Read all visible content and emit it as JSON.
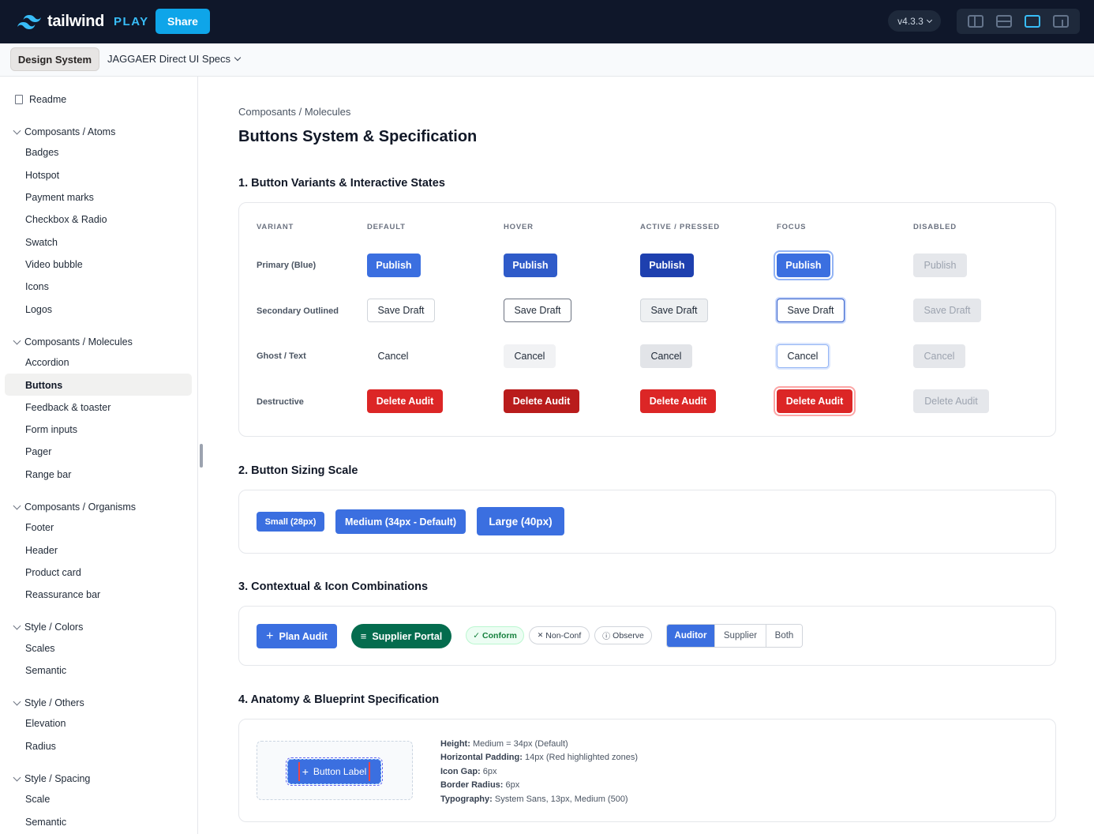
{
  "topbar": {
    "logo_text": "tailwind",
    "logo_suffix": "PLAY",
    "share_label": "Share",
    "version": "v4.3.3",
    "layout_icons": [
      "layout-split-vertical-icon",
      "layout-split-horizontal-icon",
      "layout-preview-icon",
      "layout-responsive-icon"
    ]
  },
  "subbar": {
    "active_tab": "Design System",
    "document": "JAGGAER Direct UI Specs"
  },
  "sidebar": {
    "readme": "Readme",
    "groups": [
      {
        "label": "Composants / Atoms",
        "items": [
          "Badges",
          "Hotspot",
          "Payment marks",
          "Checkbox & Radio",
          "Swatch",
          "Video bubble",
          "Icons",
          "Logos"
        ]
      },
      {
        "label": "Composants / Molecules",
        "items": [
          "Accordion",
          "Buttons",
          "Feedback & toaster",
          "Form inputs",
          "Pager",
          "Range bar"
        ]
      },
      {
        "label": "Composants / Organisms",
        "items": [
          "Footer",
          "Header",
          "Product card",
          "Reassurance bar"
        ]
      },
      {
        "label": "Style / Colors",
        "items": [
          "Scales",
          "Semantic"
        ]
      },
      {
        "label": "Style / Others",
        "items": [
          "Elevation",
          "Radius"
        ]
      },
      {
        "label": "Style / Spacing",
        "items": [
          "Scale",
          "Semantic"
        ]
      }
    ],
    "active_item": "Buttons"
  },
  "main": {
    "breadcrumb": "Composants / Molecules",
    "title": "Buttons System & Specification",
    "section1": {
      "title": "1. Button Variants & Interactive States",
      "columns": [
        "VARIANT",
        "DEFAULT",
        "HOVER",
        "ACTIVE / PRESSED",
        "FOCUS",
        "DISABLED"
      ],
      "rows": [
        {
          "label": "Primary (Blue)",
          "button": "Publish"
        },
        {
          "label": "Secondary Outlined",
          "button": "Save Draft"
        },
        {
          "label": "Ghost / Text",
          "button": "Cancel"
        },
        {
          "label": "Destructive",
          "button": "Delete Audit"
        }
      ]
    },
    "section2": {
      "title": "2. Button Sizing Scale",
      "small": "Small (28px)",
      "medium": "Medium (34px - Default)",
      "large": "Large (40px)"
    },
    "section3": {
      "title": "3. Contextual & Icon Combinations",
      "plan_audit": "Plan Audit",
      "supplier_portal": "Supplier Portal",
      "chip_conform": "Conform",
      "chip_nonconf": "Non-Conf",
      "chip_observe": "Observe",
      "segments": [
        "Auditor",
        "Supplier",
        "Both"
      ],
      "selected_segment": "Auditor",
      "plus_glyph": "+",
      "list_glyph": "≡",
      "check_glyph": "✓",
      "x_glyph": "✕",
      "info_glyph": "ⓘ"
    },
    "section4": {
      "title": "4. Anatomy & Blueprint Specification",
      "button_label": "Button Label",
      "specs": [
        {
          "key": "Height:",
          "value": "Medium = 34px (Default)"
        },
        {
          "key": "Horizontal Padding:",
          "value": "14px (Red highlighted zones)"
        },
        {
          "key": "Icon Gap:",
          "value": "6px"
        },
        {
          "key": "Border Radius:",
          "value": "6px"
        },
        {
          "key": "Typography:",
          "value": "System Sans, 13px, Medium (500)"
        }
      ]
    }
  },
  "colors": {
    "topbar_bg": "#0f172a",
    "share": "#0ea5e9",
    "primary": "#3b6fe0",
    "danger": "#dc2626",
    "supplier_portal": "#046c4e"
  }
}
